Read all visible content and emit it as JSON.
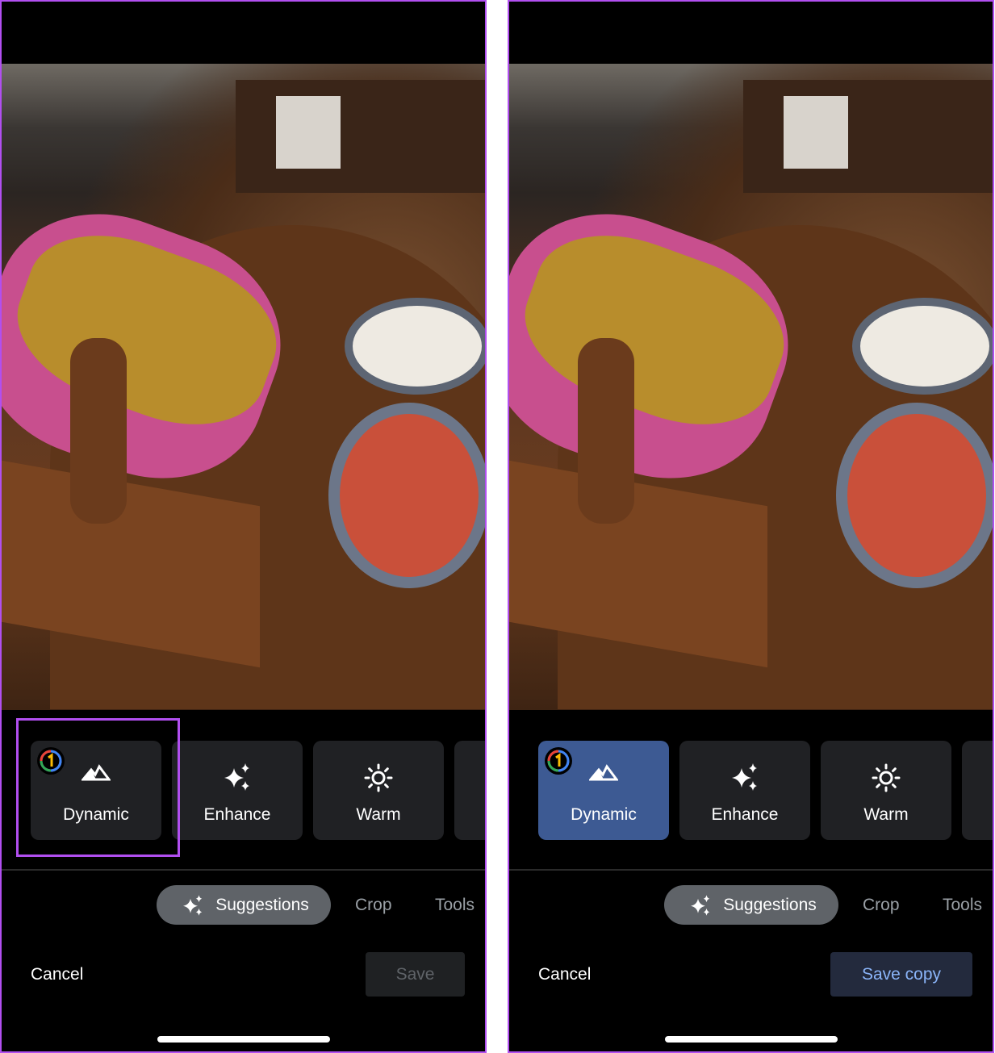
{
  "panels": [
    {
      "id": "before",
      "cards": [
        {
          "label": "Dynamic",
          "icon": "mountain-icon",
          "badge": "google-one-icon",
          "selected": false
        },
        {
          "label": "Enhance",
          "icon": "sparkle-icon"
        },
        {
          "label": "Warm",
          "icon": "sun-icon"
        },
        {
          "label": "",
          "icon": ""
        }
      ],
      "tabs": {
        "suggestions": "Suggestions",
        "crop": "Crop",
        "tools": "Tools"
      },
      "cancel": "Cancel",
      "save": "Save",
      "save_enabled": false,
      "highlight_dynamic": true
    },
    {
      "id": "after",
      "cards": [
        {
          "label": "Dynamic",
          "icon": "mountain-icon",
          "badge": "google-one-icon",
          "selected": true
        },
        {
          "label": "Enhance",
          "icon": "sparkle-icon"
        },
        {
          "label": "Warm",
          "icon": "sun-icon"
        },
        {
          "label": "",
          "icon": ""
        }
      ],
      "tabs": {
        "suggestions": "Suggestions",
        "crop": "Crop",
        "tools": "Tools"
      },
      "cancel": "Cancel",
      "save": "Save copy",
      "save_enabled": true,
      "highlight_dynamic": false
    }
  ],
  "colors": {
    "highlight": "#b14ff0",
    "selected_card": "#3d5a93",
    "card": "#202124",
    "pill": "#5f6368",
    "save_copy_bg": "#232a3d",
    "save_copy_text": "#8ab4f8",
    "save_disabled_bg": "#1f2123",
    "save_disabled_text": "#5f6368"
  }
}
